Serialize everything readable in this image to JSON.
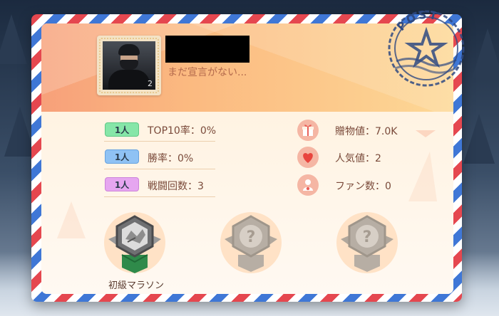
{
  "profile": {
    "declaration": "まだ宣言がない...",
    "avatar_number": "2"
  },
  "stamp": {
    "text": "POST"
  },
  "left_stats": [
    {
      "badge": "1人",
      "badge_color": "#86e6a8",
      "label": "TOP10率：0%"
    },
    {
      "badge": "1人",
      "badge_color": "#8fc2f4",
      "label": "勝率：0%"
    },
    {
      "badge": "1人",
      "badge_color": "#e6a6f0",
      "label": "戦闘回数：3"
    }
  ],
  "right_stats": [
    {
      "icon": "gift-icon",
      "label": "贈物値：7.0K"
    },
    {
      "icon": "heart-icon",
      "label": "人気値：2"
    },
    {
      "icon": "fan-user-icon",
      "label": "ファン数：0"
    }
  ],
  "medals": [
    {
      "label": "初級マラソン",
      "unlocked": true
    },
    {
      "label": "",
      "unlocked": false
    },
    {
      "label": "",
      "unlocked": false
    }
  ],
  "colors": {
    "airmail_red": "#e5474f",
    "airmail_blue": "#3f77d6",
    "header_orange": "#f7a07a",
    "text_brown": "#7a4a3a"
  }
}
